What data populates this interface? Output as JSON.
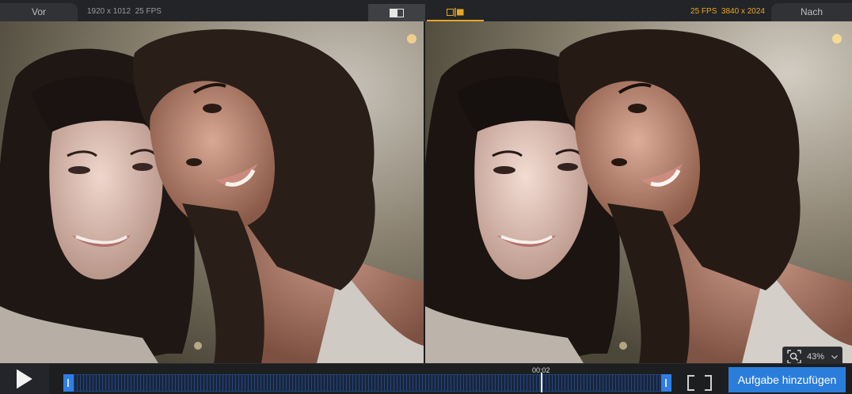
{
  "header": {
    "before_label": "Vor",
    "after_label": "Nach",
    "source_info": "1920 x 1012  25 FPS",
    "output_info": "25 FPS  3840 x 2024",
    "accent_color": "#e8a623"
  },
  "view_modes": [
    {
      "icon": "single-view-icon",
      "selected": false
    },
    {
      "icon": "split-view-icon",
      "selected": true
    }
  ],
  "zoom": {
    "icon": "zoom-fit-icon",
    "value": "43%"
  },
  "player": {
    "play_icon": "play-icon",
    "timecode": "00:02",
    "add_task_label": "Aufgabe hinzufügen",
    "add_task_color": "#2b7ddb"
  }
}
